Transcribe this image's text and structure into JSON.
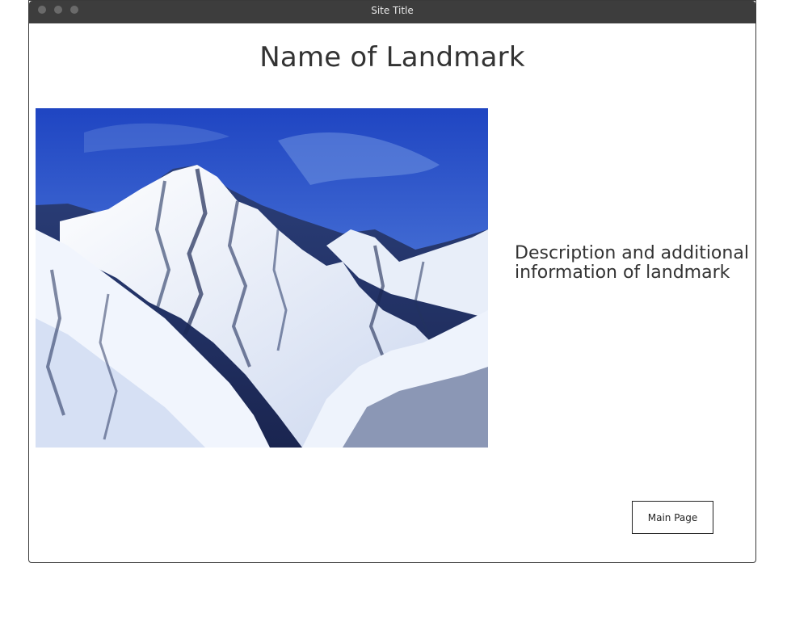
{
  "window": {
    "title": "Site Title"
  },
  "page": {
    "heading": "Name of Landmark",
    "description": "Description and additional information of landmark",
    "image_alt": "snow-capped mountain peak under blue sky"
  },
  "actions": {
    "main_page_label": "Main Page"
  }
}
